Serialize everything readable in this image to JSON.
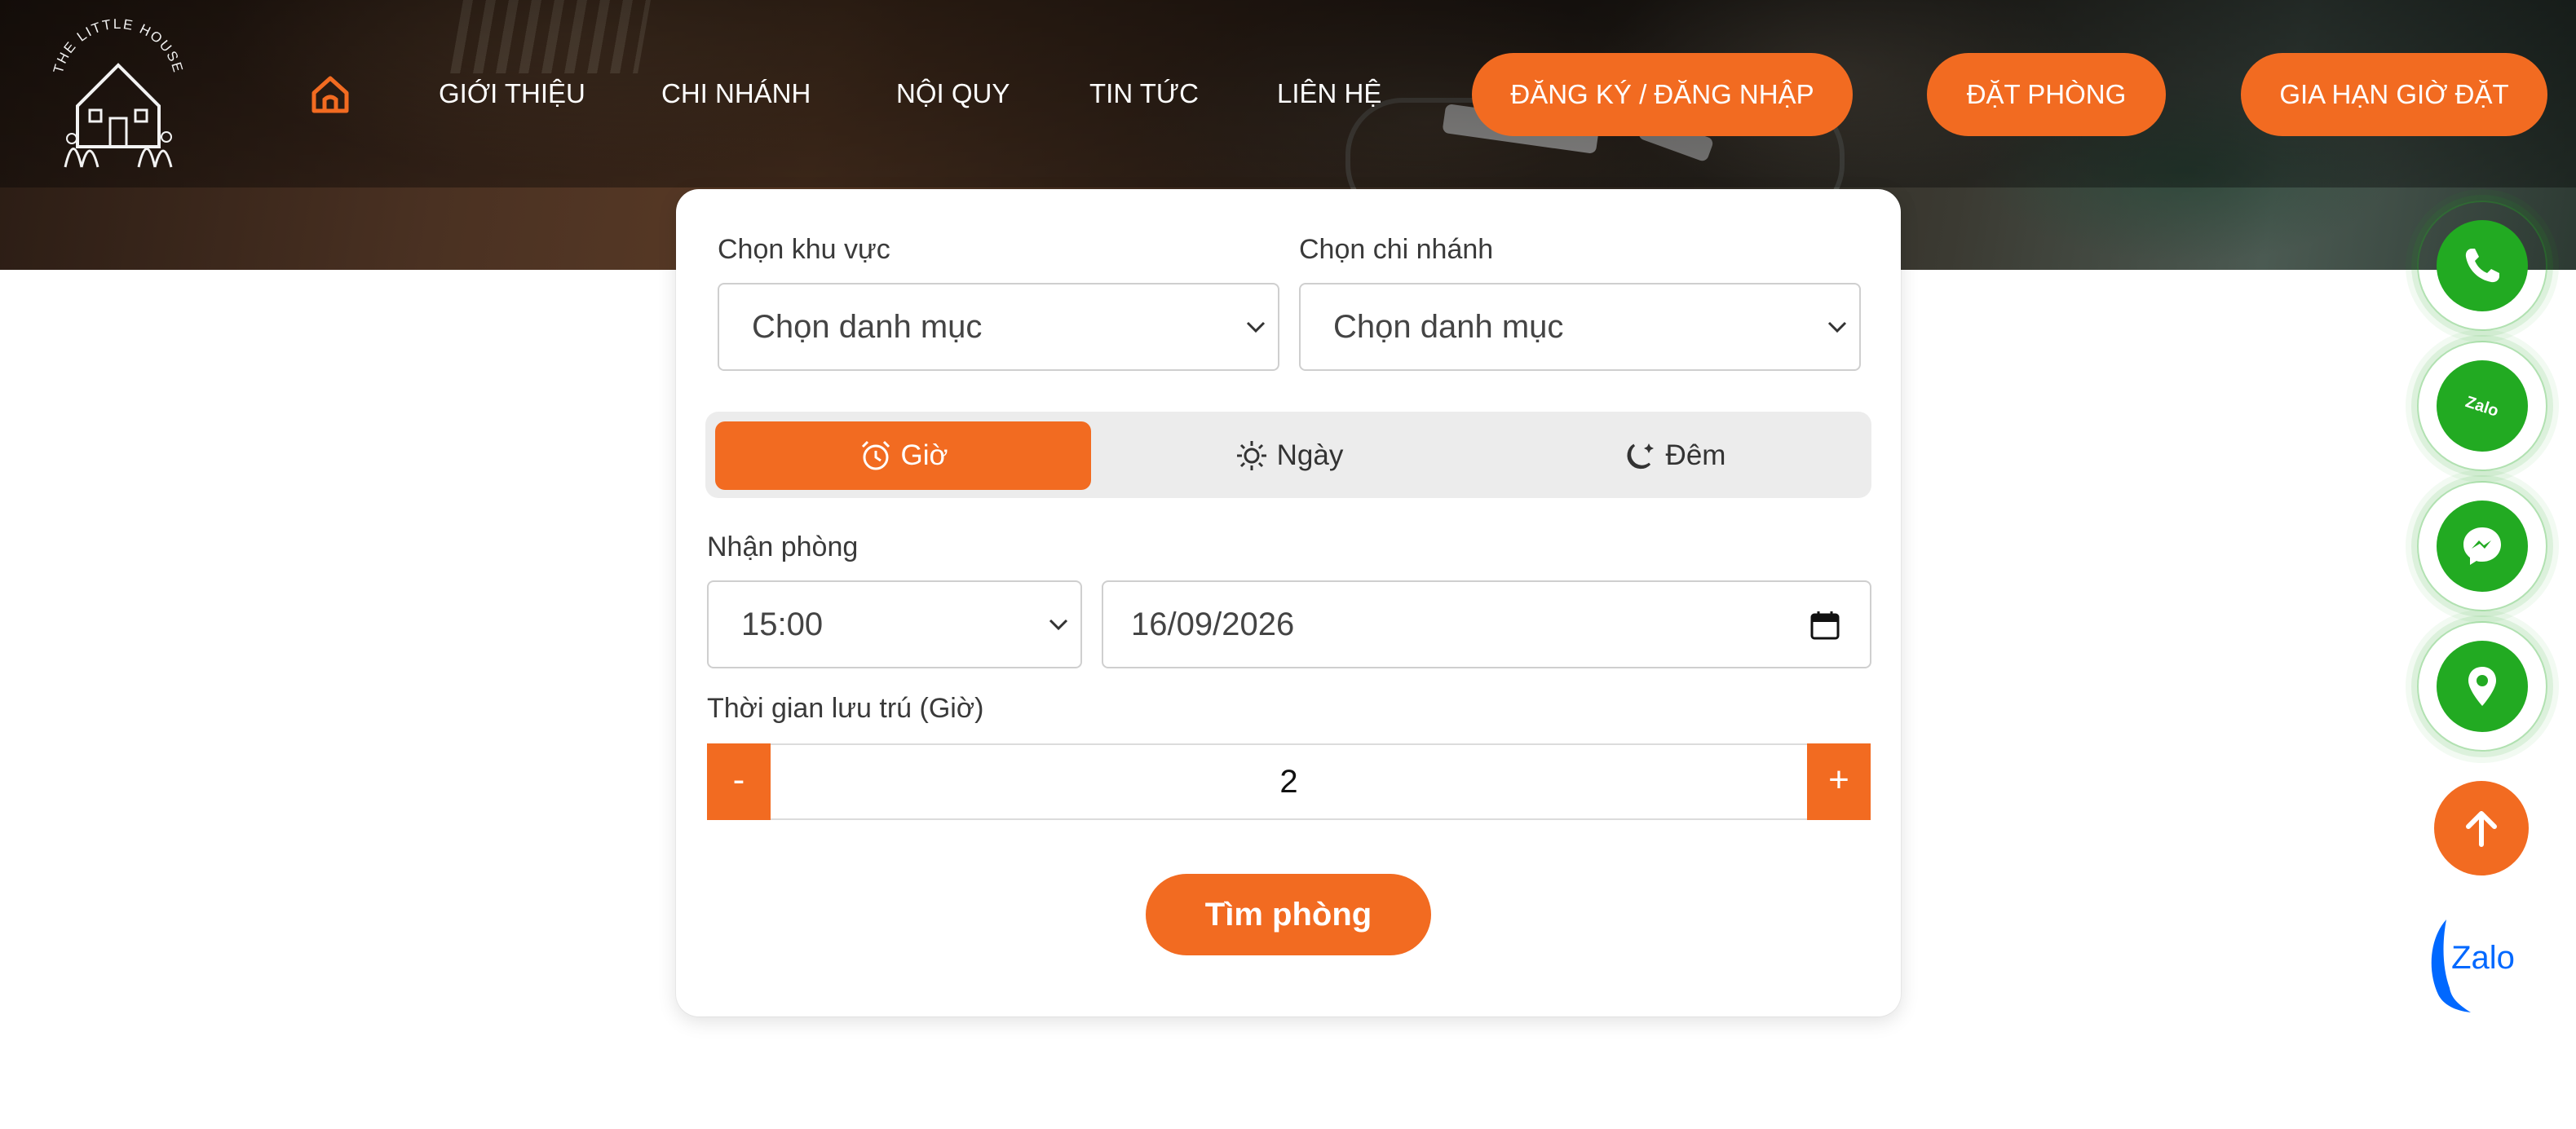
{
  "logo": {
    "text": "THE LITTLE HOUSE"
  },
  "nav": {
    "links": [
      "GIỚI THIỆU",
      "CHI NHÁNH",
      "NỘI QUY",
      "TIN TỨC",
      "LIÊN HỆ"
    ],
    "buttons": [
      "ĐĂNG KÝ / ĐĂNG NHẬP",
      "ĐẶT PHÒNG",
      "GIA HẠN GIỜ ĐẶT"
    ]
  },
  "booking": {
    "region_label": "Chọn khu vực",
    "region_value": "Chọn danh mục",
    "branch_label": "Chọn chi nhánh",
    "branch_value": "Chọn danh mục",
    "tabs": [
      "Giờ",
      "Ngày",
      "Đêm"
    ],
    "active_tab": "Giờ",
    "checkin_label": "Nhận phòng",
    "checkin_time": "15:00",
    "checkin_date": "16/09/2026",
    "stay_label": "Thời gian lưu trú (Giờ)",
    "minus": "-",
    "plus": "+",
    "stay_value": "2",
    "search_button": "Tìm phòng"
  },
  "floating": {
    "zalo_text": "Zalo",
    "zalo_badge_text": "Zalo",
    "icons": [
      "phone-icon",
      "zalo-icon",
      "messenger-icon",
      "location-pin-icon",
      "arrow-up-icon"
    ]
  },
  "colors": {
    "accent": "#f26b21",
    "contact_green": "#22aa22",
    "zalo_blue": "#0068ff"
  }
}
